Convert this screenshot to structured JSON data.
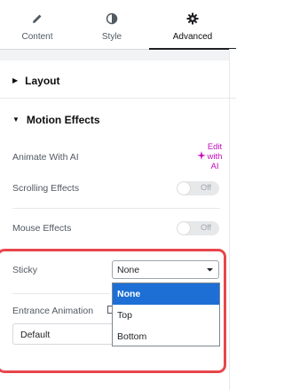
{
  "tabs": [
    {
      "label": "Content",
      "icon": "pencil-icon",
      "active": false
    },
    {
      "label": "Style",
      "icon": "contrast-icon",
      "active": false
    },
    {
      "label": "Advanced",
      "icon": "gear-icon",
      "active": true
    }
  ],
  "sections": {
    "layout": {
      "title": "Layout",
      "collapsed": true
    },
    "motion": {
      "title": "Motion Effects",
      "collapsed": false
    }
  },
  "controls": {
    "animate_ai": {
      "label": "Animate With AI",
      "button_lines": [
        "Edit",
        "with",
        "AI"
      ]
    },
    "scrolling": {
      "label": "Scrolling Effects",
      "state": "Off"
    },
    "mouse": {
      "label": "Mouse Effects",
      "state": "Off"
    },
    "sticky": {
      "label": "Sticky",
      "value": "None",
      "options": [
        "None",
        "Top",
        "Bottom"
      ],
      "selected_index": 0
    },
    "entrance": {
      "label": "Entrance Animation",
      "value": "Default"
    }
  },
  "colors": {
    "highlight": "#e8464c",
    "ai_accent": "#c00bb9",
    "selected_option": "#1d6fd6"
  }
}
